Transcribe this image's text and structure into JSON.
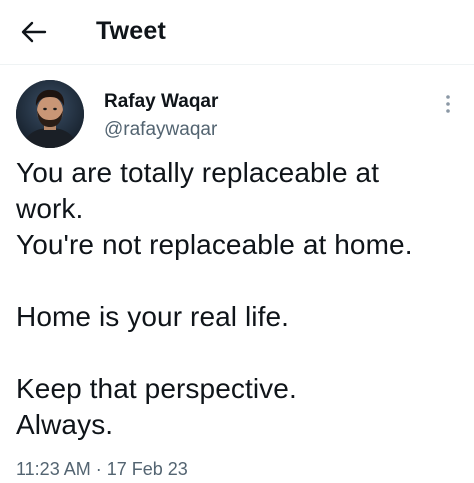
{
  "header": {
    "title": "Tweet",
    "back_icon": "arrow-left-icon"
  },
  "author": {
    "name": "Rafay Waqar",
    "handle": "@rafaywaqar",
    "more_icon": "more-vertical-icon"
  },
  "tweet": {
    "lines": [
      "You are totally replaceable at",
      "work.",
      "You're not replaceable at home.",
      "",
      "Home is your real life.",
      "",
      "Keep that perspective.",
      "Always."
    ]
  },
  "meta": {
    "time": "11:23 AM",
    "separator": "·",
    "date": "17 Feb 23"
  },
  "colors": {
    "text": "#0f1419",
    "secondary": "#536471",
    "divider": "#eff3f4"
  }
}
